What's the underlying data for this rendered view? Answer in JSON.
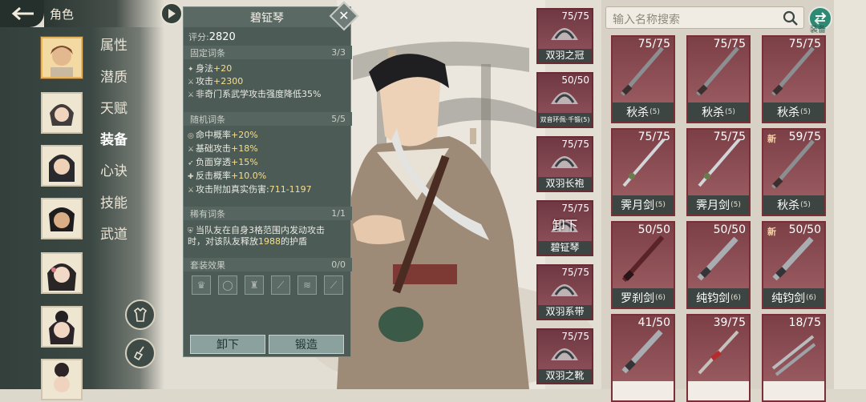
{
  "header": {
    "title": "角色"
  },
  "nav": [
    "属性",
    "潜质",
    "天赋",
    "装备",
    "心诀",
    "技能",
    "武道"
  ],
  "nav_active": 3,
  "detail": {
    "name": "碧钲琴",
    "score_label": "评分:",
    "score": "2820",
    "fixed": {
      "label": "固定词条",
      "count": "3/3",
      "lines": [
        {
          "t": "身法",
          "v": "+20"
        },
        {
          "t": "攻击",
          "v": "+2300"
        },
        {
          "t": "非奇门系武学攻击强度降低35%",
          "v": ""
        }
      ]
    },
    "random": {
      "label": "随机词条",
      "count": "5/5",
      "lines": [
        {
          "t": "命中概率",
          "v": "+20%"
        },
        {
          "t": "基础攻击",
          "v": "+18%"
        },
        {
          "t": "负面穿透",
          "v": "+15%"
        },
        {
          "t": "反击概率",
          "v": "+10.0%"
        },
        {
          "t": "攻击附加真实伤害:",
          "v": "711-1197"
        }
      ]
    },
    "rare": {
      "label": "稀有词条",
      "count": "1/1",
      "line1": "当队友在自身3格范围内发动攻击",
      "line2_a": "时，对该队友释放",
      "line2_v": "1988",
      "line2_b": "的护盾"
    },
    "set": {
      "label": "套装效果",
      "count": "0/0"
    },
    "btn_unequip": "卸下",
    "btn_forge": "锻造"
  },
  "equipped": [
    {
      "name": "双羽之冠",
      "count": "75/75",
      "small": false
    },
    {
      "name": "双音环佩·千锻(5)",
      "count": "50/50",
      "small": true
    },
    {
      "name": "双羽长袍",
      "count": "75/75",
      "small": false
    },
    {
      "name": "碧钲琴",
      "count": "75/75",
      "small": false,
      "overlay": "卸下"
    },
    {
      "name": "双羽系带",
      "count": "75/75",
      "small": false
    },
    {
      "name": "双羽之靴",
      "count": "75/75",
      "small": false
    }
  ],
  "search": {
    "placeholder": "输入名称搜索"
  },
  "equip_toggle": "装备",
  "inventory": [
    {
      "name": "秋杀",
      "lv": "(5)",
      "count": "75/75",
      "new": false,
      "weapon": "sabre"
    },
    {
      "name": "秋杀",
      "lv": "(5)",
      "count": "75/75",
      "new": false,
      "weapon": "sabre"
    },
    {
      "name": "秋杀",
      "lv": "(5)",
      "count": "75/75",
      "new": false,
      "weapon": "sabre"
    },
    {
      "name": "霁月剑",
      "lv": "(5)",
      "count": "75/75",
      "new": false,
      "weapon": "sword"
    },
    {
      "name": "霁月剑",
      "lv": "(5)",
      "count": "75/75",
      "new": false,
      "weapon": "sword"
    },
    {
      "name": "秋杀",
      "lv": "(5)",
      "count": "59/75",
      "new": true,
      "weapon": "sabre"
    },
    {
      "name": "罗刹剑",
      "lv": "(6)",
      "count": "50/50",
      "new": false,
      "weapon": "dark"
    },
    {
      "name": "纯钧剑",
      "lv": "(6)",
      "count": "50/50",
      "new": false,
      "weapon": "broad"
    },
    {
      "name": "纯钧剑",
      "lv": "(6)",
      "count": "50/50",
      "new": true,
      "weapon": "broad"
    },
    {
      "name": "",
      "lv": "",
      "count": "41/50",
      "new": false,
      "weapon": "broad"
    },
    {
      "name": "",
      "lv": "",
      "count": "39/75",
      "new": false,
      "weapon": "red"
    },
    {
      "name": "",
      "lv": "",
      "count": "18/75",
      "new": false,
      "weapon": "twin"
    }
  ],
  "new_badge": "新",
  "colors": {
    "item_bg": "#8a4e57",
    "panel": "#4d5b57",
    "accent": "#f5df8f",
    "toggle": "#2f8a73"
  }
}
